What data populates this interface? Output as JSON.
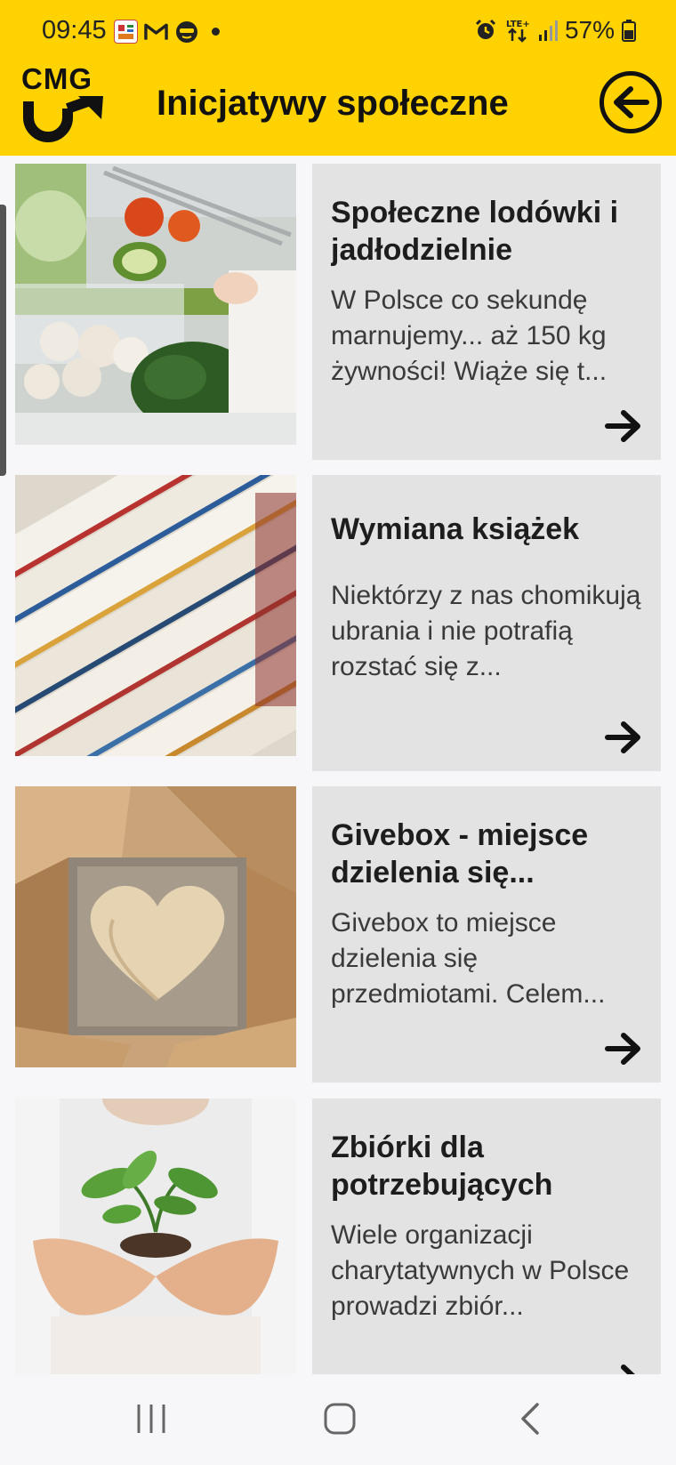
{
  "status_bar": {
    "time": "09:45",
    "battery": "57%",
    "network": "LTE+"
  },
  "header": {
    "logo_text": "CMG",
    "title": "Inicjatywy społeczne",
    "accent_color": "#ffd200"
  },
  "cards": [
    {
      "title": "Społeczne lodówki i jadłodzielnie",
      "description": "W Polsce co sekundę marnujemy... aż 150 kg żywności! Wiąże się t...",
      "image": "fridge-vegetables-image"
    },
    {
      "title": "Wymiana książek",
      "description": "Niektórzy z nas chomikują ubrania i nie potrafią rozstać się z...",
      "image": "books-stack-image"
    },
    {
      "title": "Givebox - miejsce dzielenia się...",
      "description": "Givebox to miejsce dzielenia się przedmiotami. Celem...",
      "image": "heart-box-image"
    },
    {
      "title": "Zbiórki dla potrzebujących",
      "description": "Wiele organizacji charytatywnych w Polsce prowadzi zbiór...",
      "image": "hands-plant-image"
    }
  ],
  "nav": {
    "recent": "recent-apps-icon",
    "home": "home-icon",
    "back": "back-icon"
  }
}
